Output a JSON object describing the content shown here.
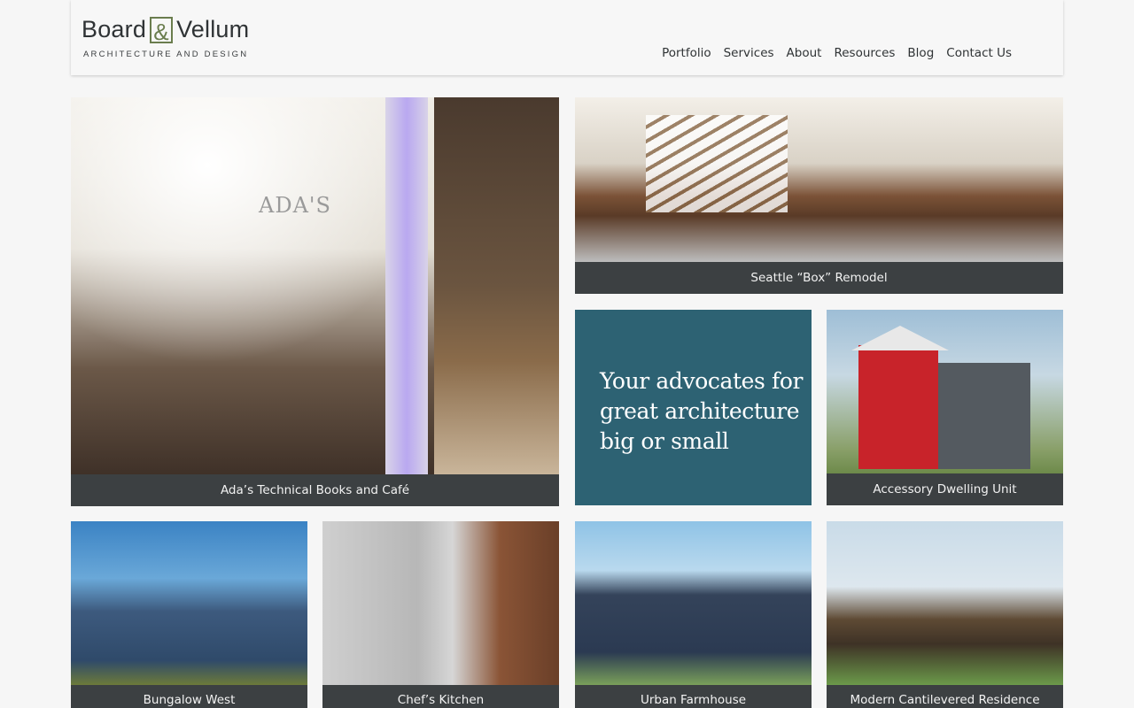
{
  "header": {
    "logo_name_left": "Board",
    "logo_amp": "&",
    "logo_name_right": "Vellum",
    "logo_tagline": "ARCHITECTURE AND DESIGN",
    "nav": [
      "Portfolio",
      "Services",
      "About",
      "Resources",
      "Blog",
      "Contact Us"
    ]
  },
  "tiles": {
    "ada": {
      "caption": "Ada’s Technical Books and Café",
      "sign": "ADA'S"
    },
    "box": {
      "caption": "Seattle “Box” Remodel"
    },
    "advocate": {
      "text": "Your advocates for great architecture big or small"
    },
    "adu": {
      "caption": "Accessory Dwelling Unit"
    },
    "bungalow": {
      "caption": "Bungalow West"
    },
    "chef": {
      "caption": "Chef’s Kitchen"
    },
    "urban": {
      "caption": "Urban Farmhouse"
    },
    "modern": {
      "caption": "Modern Cantilevered Residence"
    }
  },
  "colors": {
    "caption_bg": "#3c4042",
    "advocate_bg": "#2d6273",
    "logo_accent": "#6a7d4e"
  }
}
